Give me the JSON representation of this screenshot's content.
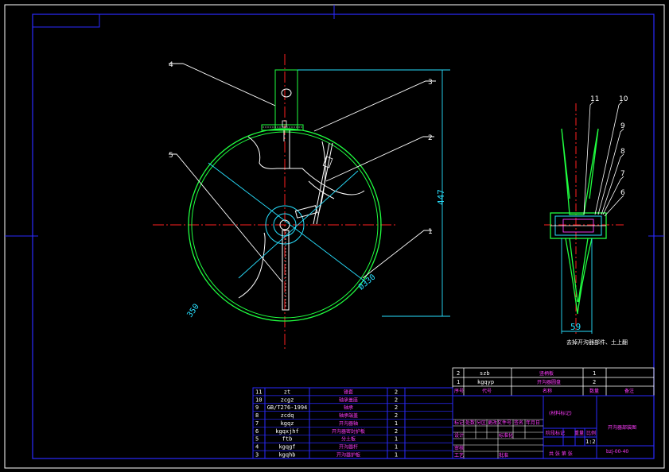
{
  "drawing": {
    "part_numbers_front": [
      "4",
      "3",
      "2",
      "5",
      "1"
    ],
    "part_numbers_side": [
      "11",
      "10",
      "9",
      "8",
      "7",
      "6"
    ],
    "dim_height": "447",
    "dim_d1": "Ø330",
    "dim_d2": "350",
    "dim_width": "59",
    "side_note": "去掉开沟器部件、土上翻"
  },
  "title_block": {
    "material": "(材料标记)",
    "drawing_name": "开沟器部装图",
    "drawing_number": "bzj-00-40",
    "scale": "1:2",
    "stage_label": "阶段标记",
    "weight_label": "重量",
    "scale_label": "比例",
    "sheet_label": "共 张 第 张",
    "sign_rows": [
      "标记",
      "设计",
      "审核",
      "工艺"
    ],
    "sign_cols": [
      "处数",
      "分区",
      "更改文件号",
      "签名",
      "年月日"
    ],
    "std_label": "标准化",
    "approve_label": "批准"
  },
  "upper_list": {
    "header": [
      "序号",
      "代号",
      "名称",
      "数量",
      "备注"
    ],
    "rows": [
      {
        "no": "2",
        "code": "szb",
        "name": "竖柄板",
        "qty": "1"
      },
      {
        "no": "1",
        "code": "kgqyp",
        "name": "开沟器圆盘",
        "qty": "2"
      }
    ]
  },
  "parts_list": {
    "rows": [
      {
        "no": "11",
        "code": "zt",
        "name": "锥套",
        "qty": "2"
      },
      {
        "no": "10",
        "code": "zcgz",
        "name": "轴承盖座",
        "qty": "2"
      },
      {
        "no": "9",
        "code": "GB/T276-1994",
        "name": "轴承",
        "qty": "2"
      },
      {
        "no": "8",
        "code": "zcdq",
        "name": "轴承端盖",
        "qty": "2"
      },
      {
        "no": "7",
        "code": "kgqz",
        "name": "开沟器轴",
        "qty": "1"
      },
      {
        "no": "6",
        "code": "kgqxjhf",
        "name": "开沟器密封护板",
        "qty": "2"
      },
      {
        "no": "5",
        "code": "ftb",
        "name": "分土板",
        "qty": "1"
      },
      {
        "no": "4",
        "code": "kgqgf",
        "name": "开沟器杆",
        "qty": "1"
      },
      {
        "no": "3",
        "code": "kgqhb",
        "name": "开沟器护板",
        "qty": "1"
      }
    ]
  }
}
